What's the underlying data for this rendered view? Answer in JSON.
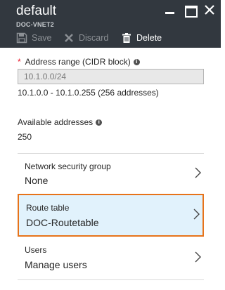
{
  "header": {
    "title": "default",
    "subtitle": "DOC-VNET2"
  },
  "toolbar": {
    "save_label": "Save",
    "discard_label": "Discard",
    "delete_label": "Delete"
  },
  "address_range": {
    "label": "Address range (CIDR block)",
    "value": "10.1.0.0/24",
    "range_text": "10.1.0.0 - 10.1.0.255 (256 addresses)"
  },
  "available": {
    "label": "Available addresses",
    "value": "250"
  },
  "rows": [
    {
      "label": "Network security group",
      "value": "None"
    },
    {
      "label": "Route table",
      "value": "DOC-Routetable"
    },
    {
      "label": "Users",
      "value": "Manage users"
    }
  ],
  "colors": {
    "header_bg": "#32383f",
    "selected_bg": "#e1f2fc",
    "selected_border": "#e7731a",
    "required": "#e81123"
  }
}
